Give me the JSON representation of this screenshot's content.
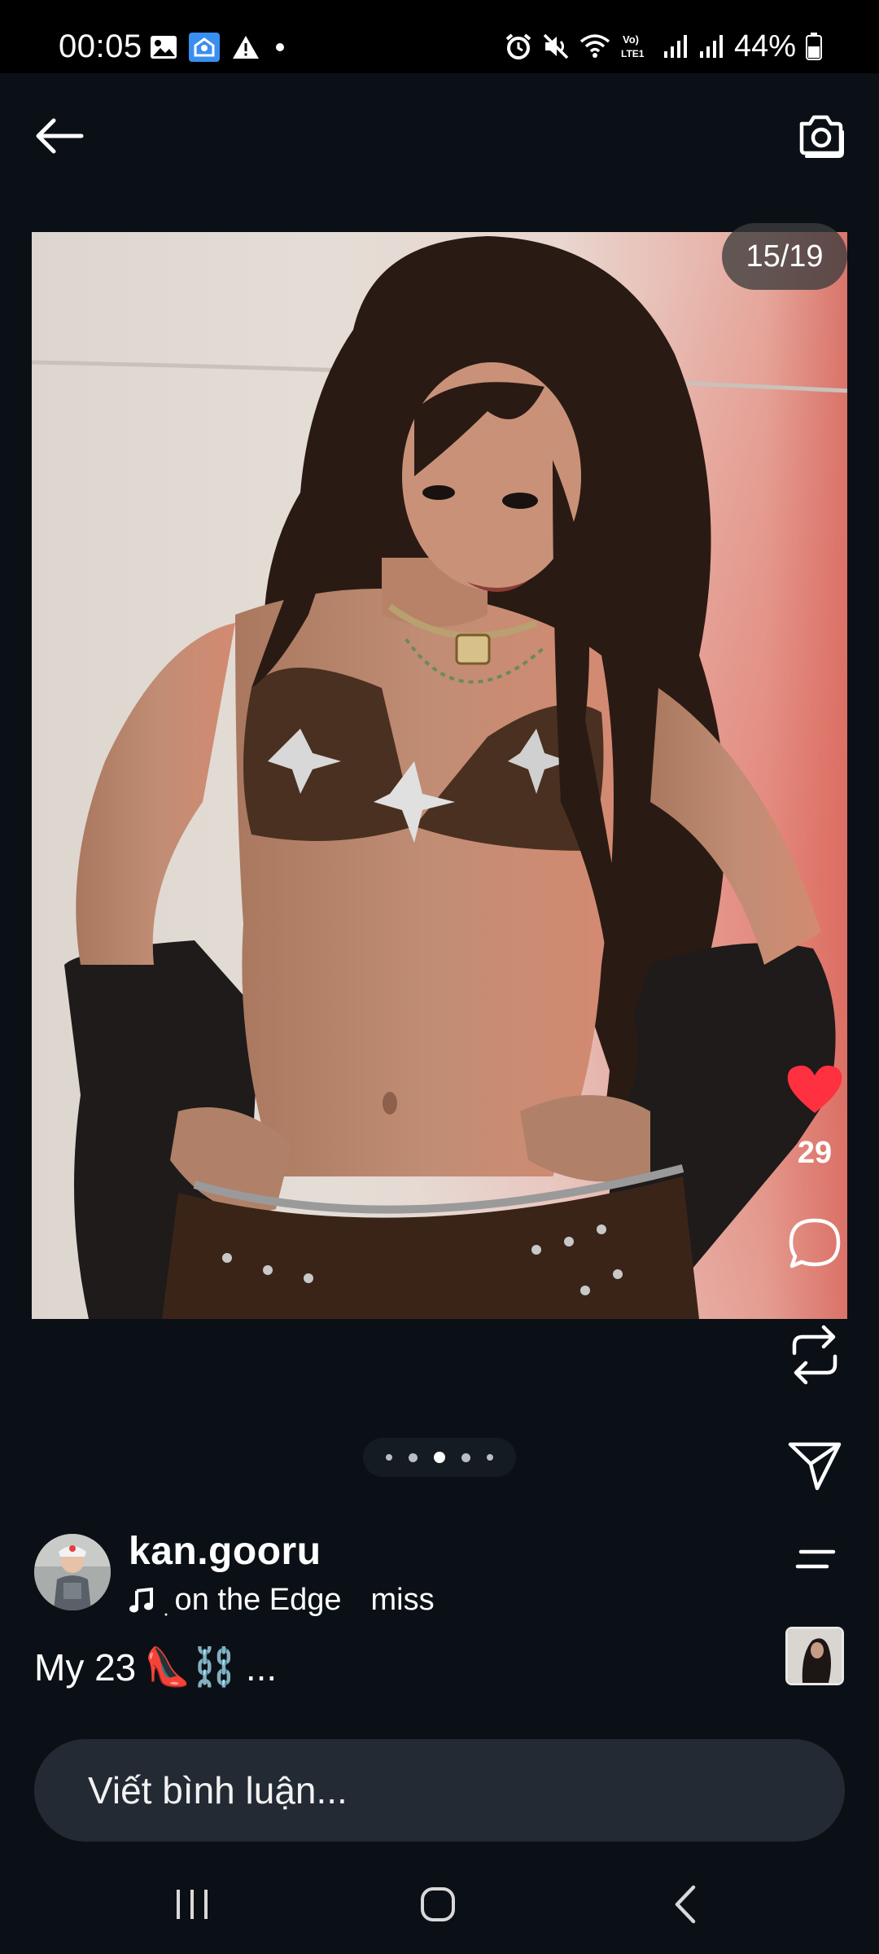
{
  "status_bar": {
    "time": "00:05",
    "battery_text": "44%",
    "left_icons": [
      "gallery-icon",
      "home-notification-icon",
      "warning-icon",
      "dot-icon"
    ],
    "right_icons": [
      "alarm-icon",
      "mute-icon",
      "wifi-icon",
      "volte-icon",
      "signal-icon",
      "signal-icon",
      "battery-icon"
    ],
    "volte_label": "Vo) LTE1"
  },
  "top_bar": {
    "back_icon": "arrow-left-icon",
    "camera_icon": "camera-icon"
  },
  "post": {
    "page_counter": "15/19",
    "likes": "29",
    "liked": true,
    "accent_like_color": "#ff3040",
    "author": {
      "username": "kan.gooru",
      "music_icon": "music-note-icon",
      "music_title": "ׅ on the Edge",
      "music_artist": "miss"
    },
    "caption": {
      "text": "My 23",
      "emojis": "👠⛓️",
      "more": "..."
    },
    "carousel": {
      "active_index": 2,
      "dot_count": 5
    }
  },
  "actions": {
    "like_icon": "heart-icon",
    "comment_icon": "comment-icon",
    "repost_icon": "repost-icon",
    "share_icon": "send-icon",
    "menu_icon": "menu-lines-icon"
  },
  "comment": {
    "placeholder": "Viết bình luận..."
  },
  "nav_bar": {
    "recent_icon": "recent-apps-icon",
    "home_icon": "home-icon",
    "back_icon": "nav-back-icon"
  }
}
